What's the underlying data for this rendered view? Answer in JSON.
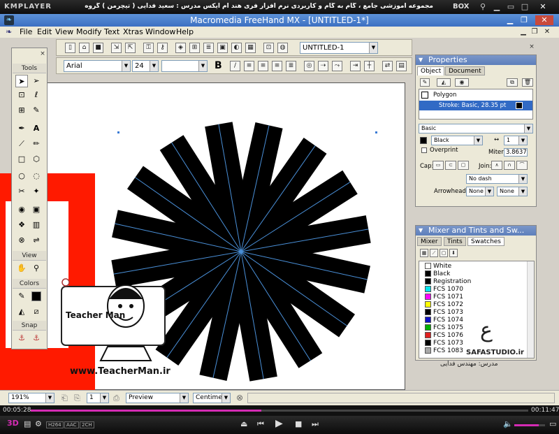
{
  "player": {
    "logo": "KMPLAYER",
    "title": "مجموعه آموزشی جامع ، گام به گام و کاربردی نرم افزار فری هند ام ایکس   مدرس : سعید فدایی ( تیچرمن ) گروه آموزشی پادشاه گرافیست ها",
    "box_label": "BOX",
    "time_elapsed": "00:05:28",
    "time_total": "00:11:47",
    "progress": 0.464,
    "codec_badges": [
      "H264",
      "AAC",
      "2CH"
    ],
    "volume": 0.8
  },
  "app": {
    "title": "Macromedia FreeHand MX - [UNTITLED-1*]"
  },
  "menu": {
    "items": [
      "File",
      "Edit",
      "View",
      "Modify",
      "Text",
      "Xtras",
      "Window",
      "Help"
    ]
  },
  "toolbar": {
    "document_select": "UNTITLED-1",
    "font_select": "Arial",
    "size_select": "24",
    "style_select": "",
    "bold_label": "B"
  },
  "tools_panel": {
    "title": "Tools",
    "view_label": "View",
    "colors_label": "Colors",
    "snap_label": "Snap"
  },
  "properties": {
    "title": "Properties",
    "tab_object": "Object",
    "tab_document": "Document",
    "list_item_polygon": "Polygon",
    "list_item_stroke": "Stroke: Basic, 28.35 pt",
    "stroke_type": "Basic",
    "color_name": "Black",
    "width_value": "1",
    "overprint_label": "Overprint",
    "miter_label": "Miter:",
    "miter_value": "3.8637",
    "cap_label": "Cap:",
    "join_label": "Join:",
    "dash_value": "No dash",
    "arrowheads_label": "Arrowheads:",
    "arrow_left": "None",
    "arrow_right": "None"
  },
  "mixer": {
    "title": "Mixer and Tints and Sw...",
    "tab_mixer": "Mixer",
    "tab_tints": "Tints",
    "tab_swatches": "Swatches",
    "swatches": [
      {
        "name": "White",
        "color": "#ffffff"
      },
      {
        "name": "Black",
        "color": "#000000"
      },
      {
        "name": "Registration",
        "color": "#000000"
      },
      {
        "name": "FCS 1070",
        "color": "#00e5ee"
      },
      {
        "name": "FCS 1071",
        "color": "#ff00ff"
      },
      {
        "name": "FCS 1072",
        "color": "#ffff00"
      },
      {
        "name": "FCS 1073",
        "color": "#000000"
      },
      {
        "name": "FCS 1074",
        "color": "#1010c8"
      },
      {
        "name": "FCS 1075",
        "color": "#00b000"
      },
      {
        "name": "FCS 1076",
        "color": "#e02020"
      },
      {
        "name": "FCS 1073",
        "color": "#000000"
      },
      {
        "name": "FCS 1083",
        "color": "#a8a8a8"
      }
    ]
  },
  "status": {
    "zoom": "191%",
    "page": "1",
    "view_mode": "Preview",
    "units": "Centimeter"
  },
  "watermark": {
    "teacher_label": "Teacher Man",
    "url": "www.TeacherMan.ir",
    "studio": "SAFASTUDIO.ir",
    "teacher_name": "مدرس: مهندس فدایی"
  },
  "colors": {
    "accent_blue": "#4d7ec8",
    "red_shape": "#ff1a00",
    "star_fill": "#000000",
    "star_stroke": "#4a90d9",
    "progress_fill": "#d42bb3"
  }
}
